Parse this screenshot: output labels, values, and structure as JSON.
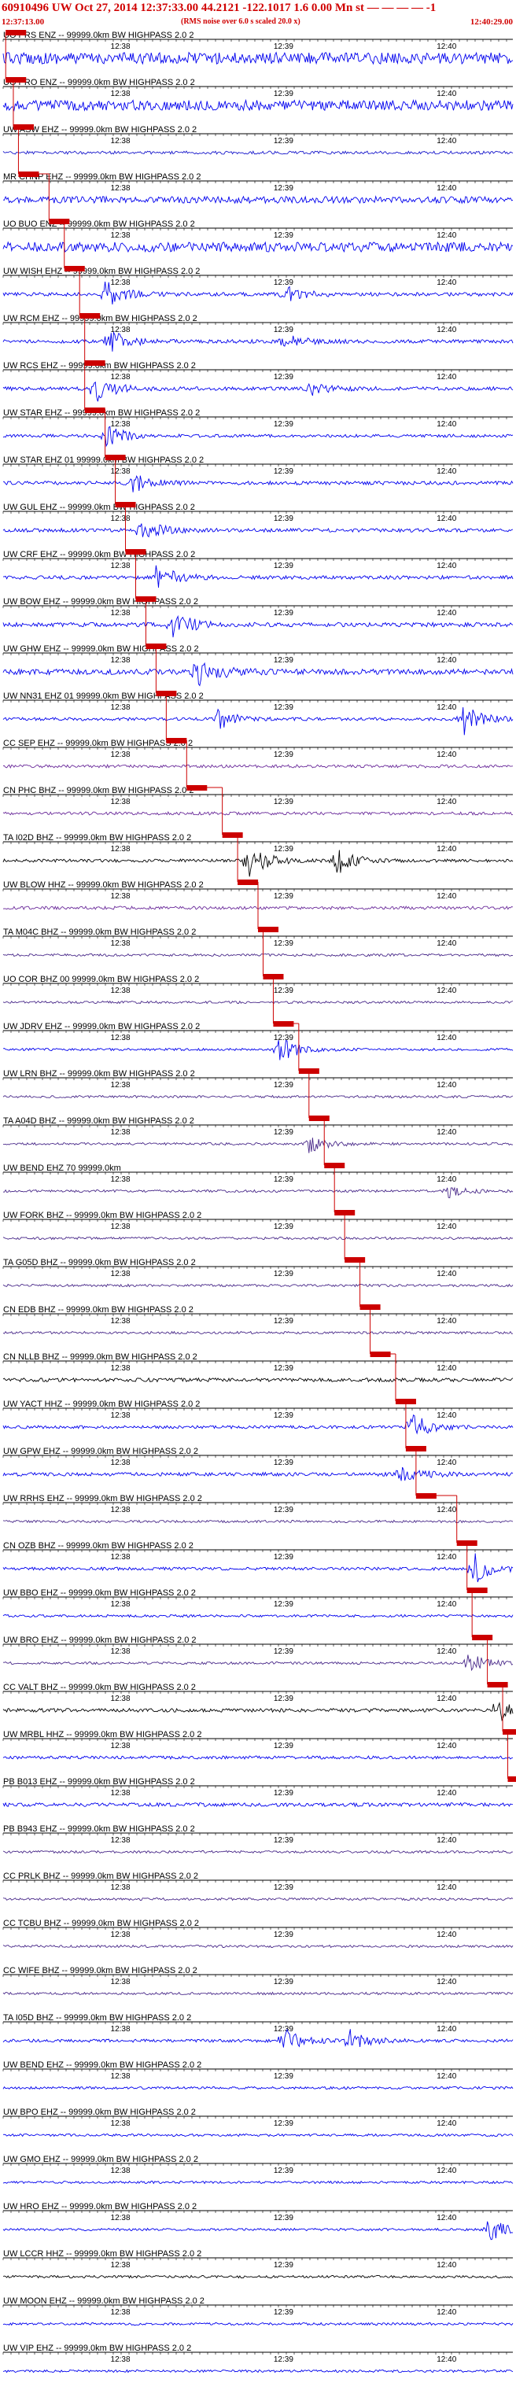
{
  "header": {
    "title": "60910496 UW Oct 27, 2014 12:37:33.00   44.2121 -122.1017  1.6 0.00 Mn st — — — —  -1",
    "start_time": "12:37:13.00",
    "note": "(RMS noise over 6.0 s scaled 20.0 x)",
    "end_time": "12:40:29.00"
  },
  "time_ticks": [
    "12:38",
    "12:39",
    "12:40"
  ],
  "colors": {
    "arrival_marker": "#cc0000",
    "text": "#000000",
    "grid": "#000000"
  },
  "traces": [
    {
      "label": "UO PRS ENZ -- 99999.0km BW HIGHPASS 2.0 2",
      "color": "#0000ee",
      "amp": 0.95,
      "events": [],
      "arrival": 0.005
    },
    {
      "label": "UO PRO ENZ -- 99999.0km BW HIGHPASS 2.0 2",
      "color": "#0000ee",
      "amp": 0.85,
      "events": [],
      "arrival": 0.005
    },
    {
      "label": "UW ASW EHZ -- 99999.0km BW HIGHPASS 2.0 2",
      "color": "#1a1acc",
      "amp": 0.25,
      "events": [],
      "arrival": 0.02
    },
    {
      "label": "MR CHNP EHZ -- 99999.0km BW HIGHPASS 2.0 2",
      "color": "#0000ee",
      "amp": 0.55,
      "events": [],
      "arrival": 0.03
    },
    {
      "label": "UO BUO ENZ -- 99999.0km BW HIGHPASS 2.0 2",
      "color": "#0000ee",
      "amp": 0.8,
      "events": [],
      "arrival": 0.09
    },
    {
      "label": "UW WISH EHZ -- 99999.0km BW HIGHPASS 2.0 2",
      "color": "#0000ee",
      "amp": 0.3,
      "events": [
        [
          0.2,
          0.8
        ],
        [
          0.55,
          0.5
        ]
      ],
      "arrival": 0.12
    },
    {
      "label": "UW RCM EHZ -- 99999.0km BW HIGHPASS 2.0 2",
      "color": "#0000ee",
      "amp": 0.3,
      "events": [
        [
          0.21,
          0.7
        ],
        [
          0.55,
          0.4
        ]
      ],
      "arrival": 0.15
    },
    {
      "label": "UW RCS EHZ -- 99999.0km BW HIGHPASS 2.0 2",
      "color": "#0000ee",
      "amp": 0.3,
      "events": [
        [
          0.18,
          0.8
        ],
        [
          0.6,
          0.4
        ]
      ],
      "arrival": 0.16
    },
    {
      "label": "UW STAR EHZ -- 99999.0km BW HIGHPASS 2.0 2",
      "color": "#0000ee",
      "amp": 0.25,
      "events": [
        [
          0.2,
          0.7
        ]
      ],
      "arrival": 0.16
    },
    {
      "label": "UW STAR EHZ 01 99999.0km BW HIGHPASS 2.0 2",
      "color": "#0000ee",
      "amp": 0.3,
      "events": [
        [
          0.25,
          0.6
        ]
      ],
      "arrival": 0.2
    },
    {
      "label": "UW GUL EHZ -- 99999.0km BW HIGHPASS 2.0 2",
      "color": "#0000ee",
      "amp": 0.3,
      "events": [
        [
          0.27,
          0.7
        ]
      ],
      "arrival": 0.22
    },
    {
      "label": "UW CRF EHZ -- 99999.0km BW HIGHPASS 2.0 2",
      "color": "#0000ee",
      "amp": 0.3,
      "events": [
        [
          0.3,
          0.8
        ]
      ],
      "arrival": 0.24
    },
    {
      "label": "UW BOW EHZ -- 99999.0km BW HIGHPASS 2.0 2",
      "color": "#0000ee",
      "amp": 0.35,
      "events": [
        [
          0.33,
          1.0
        ]
      ],
      "arrival": 0.26
    },
    {
      "label": "UW GHW EHZ -- 99999.0km BW HIGHPASS 2.0 2",
      "color": "#0000ee",
      "amp": 0.45,
      "events": [
        [
          0.38,
          1.0
        ]
      ],
      "arrival": 0.28
    },
    {
      "label": "UW NN31 EHZ 01 99999.0km BW HIGHPASS 2.0 2",
      "color": "#0000ee",
      "amp": 0.25,
      "events": [
        [
          0.42,
          0.6
        ],
        [
          0.9,
          1.0
        ]
      ],
      "arrival": 0.3
    },
    {
      "label": "CC SEP EHZ -- 99999.0km BW HIGHPASS 2.0 2",
      "color": "#6a2a9a",
      "amp": 0.25,
      "events": [],
      "arrival": 0.32
    },
    {
      "label": "CN PHC BHZ -- 99999.0km BW HIGHPASS 2.0 2",
      "color": "#6a2a9a",
      "amp": 0.25,
      "events": [],
      "arrival": 0.36
    },
    {
      "label": "TA I02D BHZ -- 99999.0km BW HIGHPASS 2.0 2",
      "color": "#000000",
      "amp": 0.25,
      "events": [
        [
          0.48,
          1.0
        ],
        [
          0.65,
          0.9
        ]
      ],
      "arrival": 0.43
    },
    {
      "label": "UW BLOW HHZ -- 99999.0km BW HIGHPASS 2.0 2",
      "color": "#6a2a9a",
      "amp": 0.25,
      "events": [],
      "arrival": 0.46
    },
    {
      "label": "TA M04C BHZ -- 99999.0km BW HIGHPASS 2.0 2",
      "color": "#4a2a8a",
      "amp": 0.2,
      "events": [],
      "arrival": 0.5
    },
    {
      "label": "UO COR BHZ 00 99999.0km BW HIGHPASS 2.0 2",
      "color": "#4a2a8a",
      "amp": 0.2,
      "events": [],
      "arrival": 0.51
    },
    {
      "label": "UW JDRV EHZ -- 99999.0km BW HIGHPASS 2.0 2",
      "color": "#0000ee",
      "amp": 0.2,
      "events": [
        [
          0.54,
          0.8
        ]
      ],
      "arrival": 0.53
    },
    {
      "label": "UW LRN BHZ -- 99999.0km BW HIGHPASS 2.0 2",
      "color": "#4a2a8a",
      "amp": 0.2,
      "events": [],
      "arrival": 0.58
    },
    {
      "label": "TA A04D BHZ -- 99999.0km BW HIGHPASS 2.0 2",
      "color": "#4a2a8a",
      "amp": 0.2,
      "events": [
        [
          0.6,
          0.5
        ]
      ],
      "arrival": 0.6
    },
    {
      "label": "UW BEND EHZ 70 99999.0km",
      "color": "#4a2a8a",
      "amp": 0.2,
      "events": [
        [
          0.87,
          0.4
        ]
      ],
      "arrival": 0.63
    },
    {
      "label": "UW FORK BHZ -- 99999.0km BW HIGHPASS 2.0 2",
      "color": "#4a2a8a",
      "amp": 0.2,
      "events": [],
      "arrival": 0.65
    },
    {
      "label": "TA G05D BHZ -- 99999.0km BW HIGHPASS 2.0 2",
      "color": "#4a2a8a",
      "amp": 0.2,
      "events": [],
      "arrival": 0.67
    },
    {
      "label": "CN EDB BHZ -- 99999.0km BW HIGHPASS 2.0 2",
      "color": "#4a2a8a",
      "amp": 0.2,
      "events": [],
      "arrival": 0.7
    },
    {
      "label": "CN NLLB BHZ -- 99999.0km BW HIGHPASS 2.0 2",
      "color": "#000000",
      "amp": 0.3,
      "events": [],
      "arrival": 0.72
    },
    {
      "label": "UW YACT HHZ -- 99999.0km BW HIGHPASS 2.0 2",
      "color": "#0000ee",
      "amp": 0.25,
      "events": [
        [
          0.8,
          0.8
        ]
      ],
      "arrival": 0.77
    },
    {
      "label": "UW GPW EHZ -- 99999.0km BW HIGHPASS 2.0 2",
      "color": "#0000ee",
      "amp": 0.3,
      "events": [
        [
          0.78,
          0.6
        ]
      ],
      "arrival": 0.79
    },
    {
      "label": "UW RRHS EHZ -- 99999.0km BW HIGHPASS 2.0 2",
      "color": "#4a2a8a",
      "amp": 0.2,
      "events": [],
      "arrival": 0.81
    },
    {
      "label": "CN OZB BHZ -- 99999.0km BW HIGHPASS 2.0 2",
      "color": "#0000ee",
      "amp": 0.25,
      "events": [
        [
          0.92,
          1.0
        ]
      ],
      "arrival": 0.89
    },
    {
      "label": "UW BBO EHZ -- 99999.0km BW HIGHPASS 2.0 2",
      "color": "#0000ee",
      "amp": 0.2,
      "events": [],
      "arrival": 0.91
    },
    {
      "label": "UW BRO EHZ -- 99999.0km BW HIGHPASS 2.0 2",
      "color": "#4a2a8a",
      "amp": 0.2,
      "events": [
        [
          0.91,
          0.6
        ]
      ],
      "arrival": 0.92
    },
    {
      "label": "CC VALT BHZ -- 99999.0km BW HIGHPASS 2.0 2",
      "color": "#000000",
      "amp": 0.3,
      "events": [
        [
          0.97,
          0.9
        ]
      ],
      "arrival": 0.95
    },
    {
      "label": "UW MRBL HHZ -- 99999.0km BW HIGHPASS 2.0 2",
      "color": "#0000ee",
      "amp": 0.25,
      "events": [],
      "arrival": 0.98
    },
    {
      "label": "PB B013 EHZ -- 99999.0km BW HIGHPASS 2.0 2",
      "color": "#0000ee",
      "amp": 0.3,
      "events": [],
      "arrival": 0.99
    },
    {
      "label": "PB B943 EHZ -- 99999.0km BW HIGHPASS 2.0 2",
      "color": "#4a2a8a",
      "amp": 0.2,
      "events": [],
      "arrival": -1
    },
    {
      "label": "CC PRLK BHZ -- 99999.0km BW HIGHPASS 2.0 2",
      "color": "#4a2a8a",
      "amp": 0.2,
      "events": [],
      "arrival": -1
    },
    {
      "label": "CC TCBU BHZ -- 99999.0km BW HIGHPASS 2.0 2",
      "color": "#4a2a8a",
      "amp": 0.2,
      "events": [],
      "arrival": -1
    },
    {
      "label": "CC WIFE BHZ -- 99999.0km BW HIGHPASS 2.0 2",
      "color": "#4a2a8a",
      "amp": 0.2,
      "events": [],
      "arrival": -1
    },
    {
      "label": "TA I05D BHZ -- 99999.0km BW HIGHPASS 2.0 2",
      "color": "#0000ee",
      "amp": 0.25,
      "events": [
        [
          0.55,
          0.7
        ],
        [
          0.68,
          0.6
        ]
      ],
      "arrival": -1
    },
    {
      "label": "UW BEND EHZ -- 99999.0km BW HIGHPASS 2.0 2",
      "color": "#0000ee",
      "amp": 0.2,
      "events": [],
      "arrival": -1
    },
    {
      "label": "UW BPO EHZ -- 99999.0km BW HIGHPASS 2.0 2",
      "color": "#0000ee",
      "amp": 0.2,
      "events": [],
      "arrival": -1
    },
    {
      "label": "UW GMO EHZ -- 99999.0km BW HIGHPASS 2.0 2",
      "color": "#0000ee",
      "amp": 0.2,
      "events": [],
      "arrival": -1
    },
    {
      "label": "UW HRO EHZ -- 99999.0km BW HIGHPASS 2.0 2",
      "color": "#0000ee",
      "amp": 0.2,
      "events": [
        [
          0.95,
          0.8
        ]
      ],
      "arrival": -1
    },
    {
      "label": "UW LCCR HHZ -- 99999.0km BW HIGHPASS 2.0 2",
      "color": "#000000",
      "amp": 0.2,
      "events": [],
      "arrival": -1
    },
    {
      "label": "UW MOON EHZ -- 99999.0km BW HIGHPASS 2.0 2",
      "color": "#0000ee",
      "amp": 0.2,
      "events": [],
      "arrival": -1
    },
    {
      "label": "UW VIP EHZ -- 99999.0km BW HIGHPASS 2.0 2",
      "color": "#0000ee",
      "amp": 0.2,
      "events": [],
      "arrival": -1
    }
  ]
}
